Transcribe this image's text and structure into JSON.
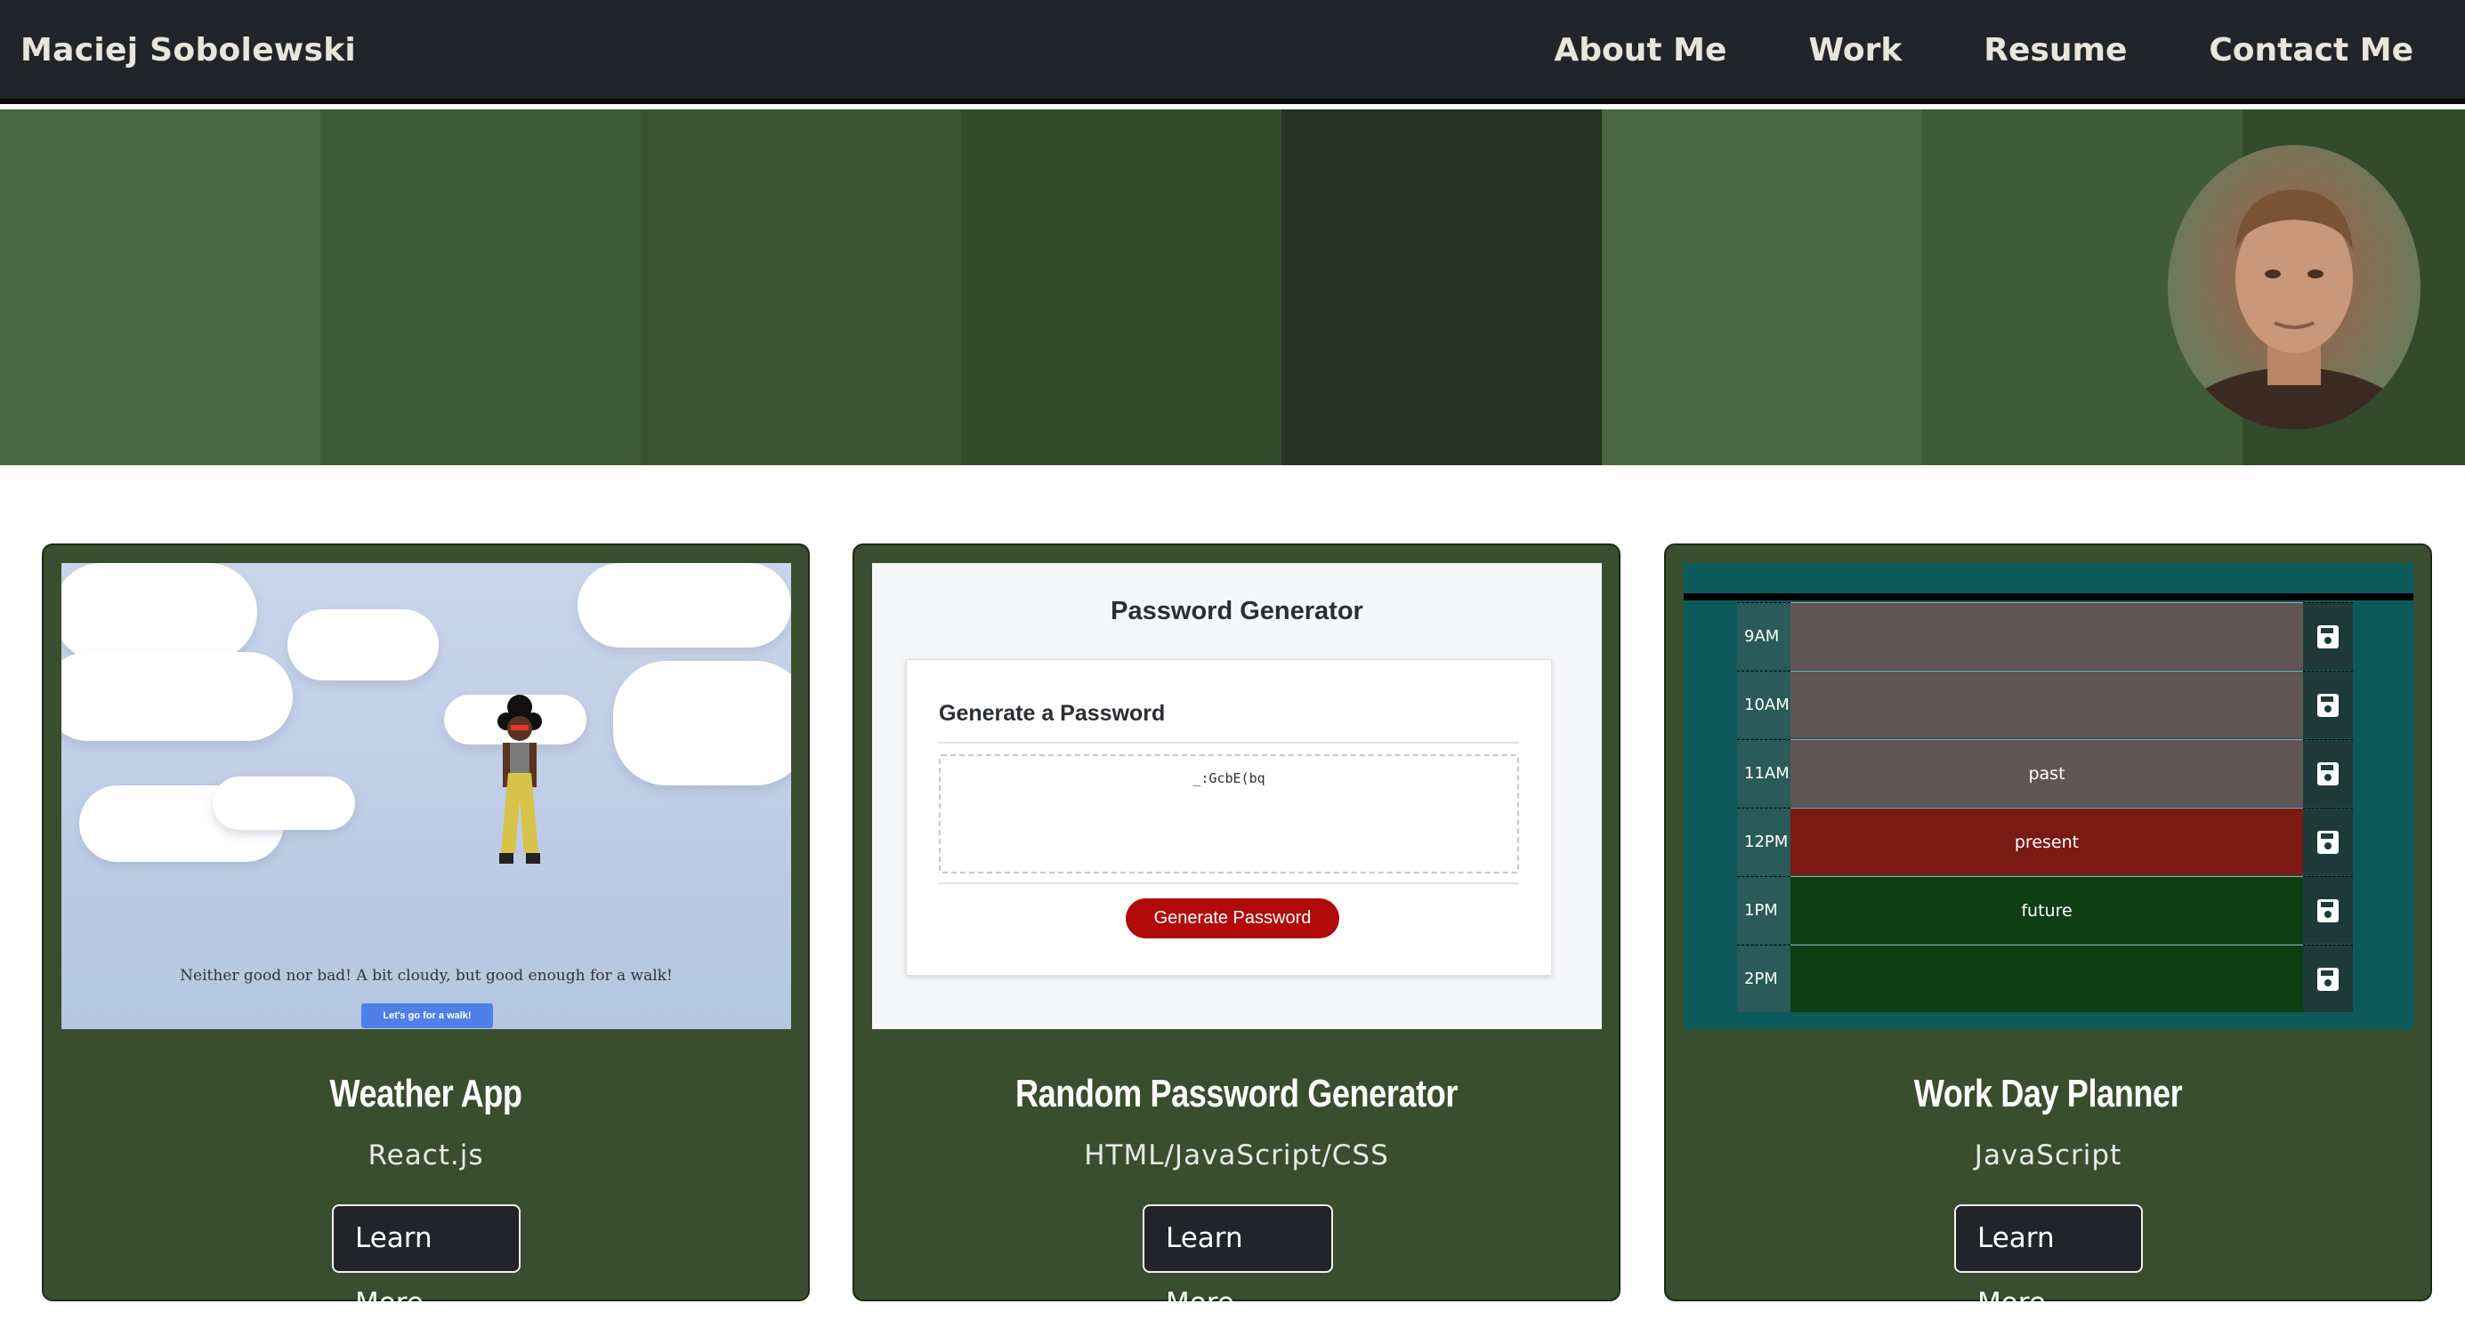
{
  "header": {
    "brand": "Maciej Sobolewski",
    "nav": [
      "About Me",
      "Work",
      "Resume",
      "Contact Me"
    ]
  },
  "hero": {
    "bands": [
      "#4a6741",
      "#3f5c36",
      "#3b5332",
      "#334a2c",
      "#243322",
      "#4a6741",
      "#3f5c36",
      "#334a2c"
    ]
  },
  "projects": [
    {
      "title": "Weather App",
      "tech": "React.js",
      "button": "Learn More",
      "preview": {
        "message": "Neither good nor bad! A bit cloudy, but good enough for a walk!",
        "button": "Let's go for a walk!"
      }
    },
    {
      "title": "Random Password Generator",
      "tech": "HTML/JavaScript/CSS",
      "button": "Learn More",
      "preview": {
        "heading": "Password Generator",
        "subheading": "Generate a Password",
        "password": "_:GcbE(bq",
        "button": "Generate Password"
      }
    },
    {
      "title": "Work Day Planner",
      "tech": "JavaScript",
      "button": "Learn More",
      "preview": {
        "rows": [
          {
            "hour": "9AM",
            "text": "",
            "state": "#625555"
          },
          {
            "hour": "10AM",
            "text": "",
            "state": "#625555"
          },
          {
            "hour": "11AM",
            "text": "past",
            "state": "#625555"
          },
          {
            "hour": "12PM",
            "text": "present",
            "state": "#7b1a15"
          },
          {
            "hour": "1PM",
            "text": "future",
            "state": "#0e3e12"
          },
          {
            "hour": "2PM",
            "text": "",
            "state": "#0e3e12"
          }
        ]
      }
    }
  ]
}
